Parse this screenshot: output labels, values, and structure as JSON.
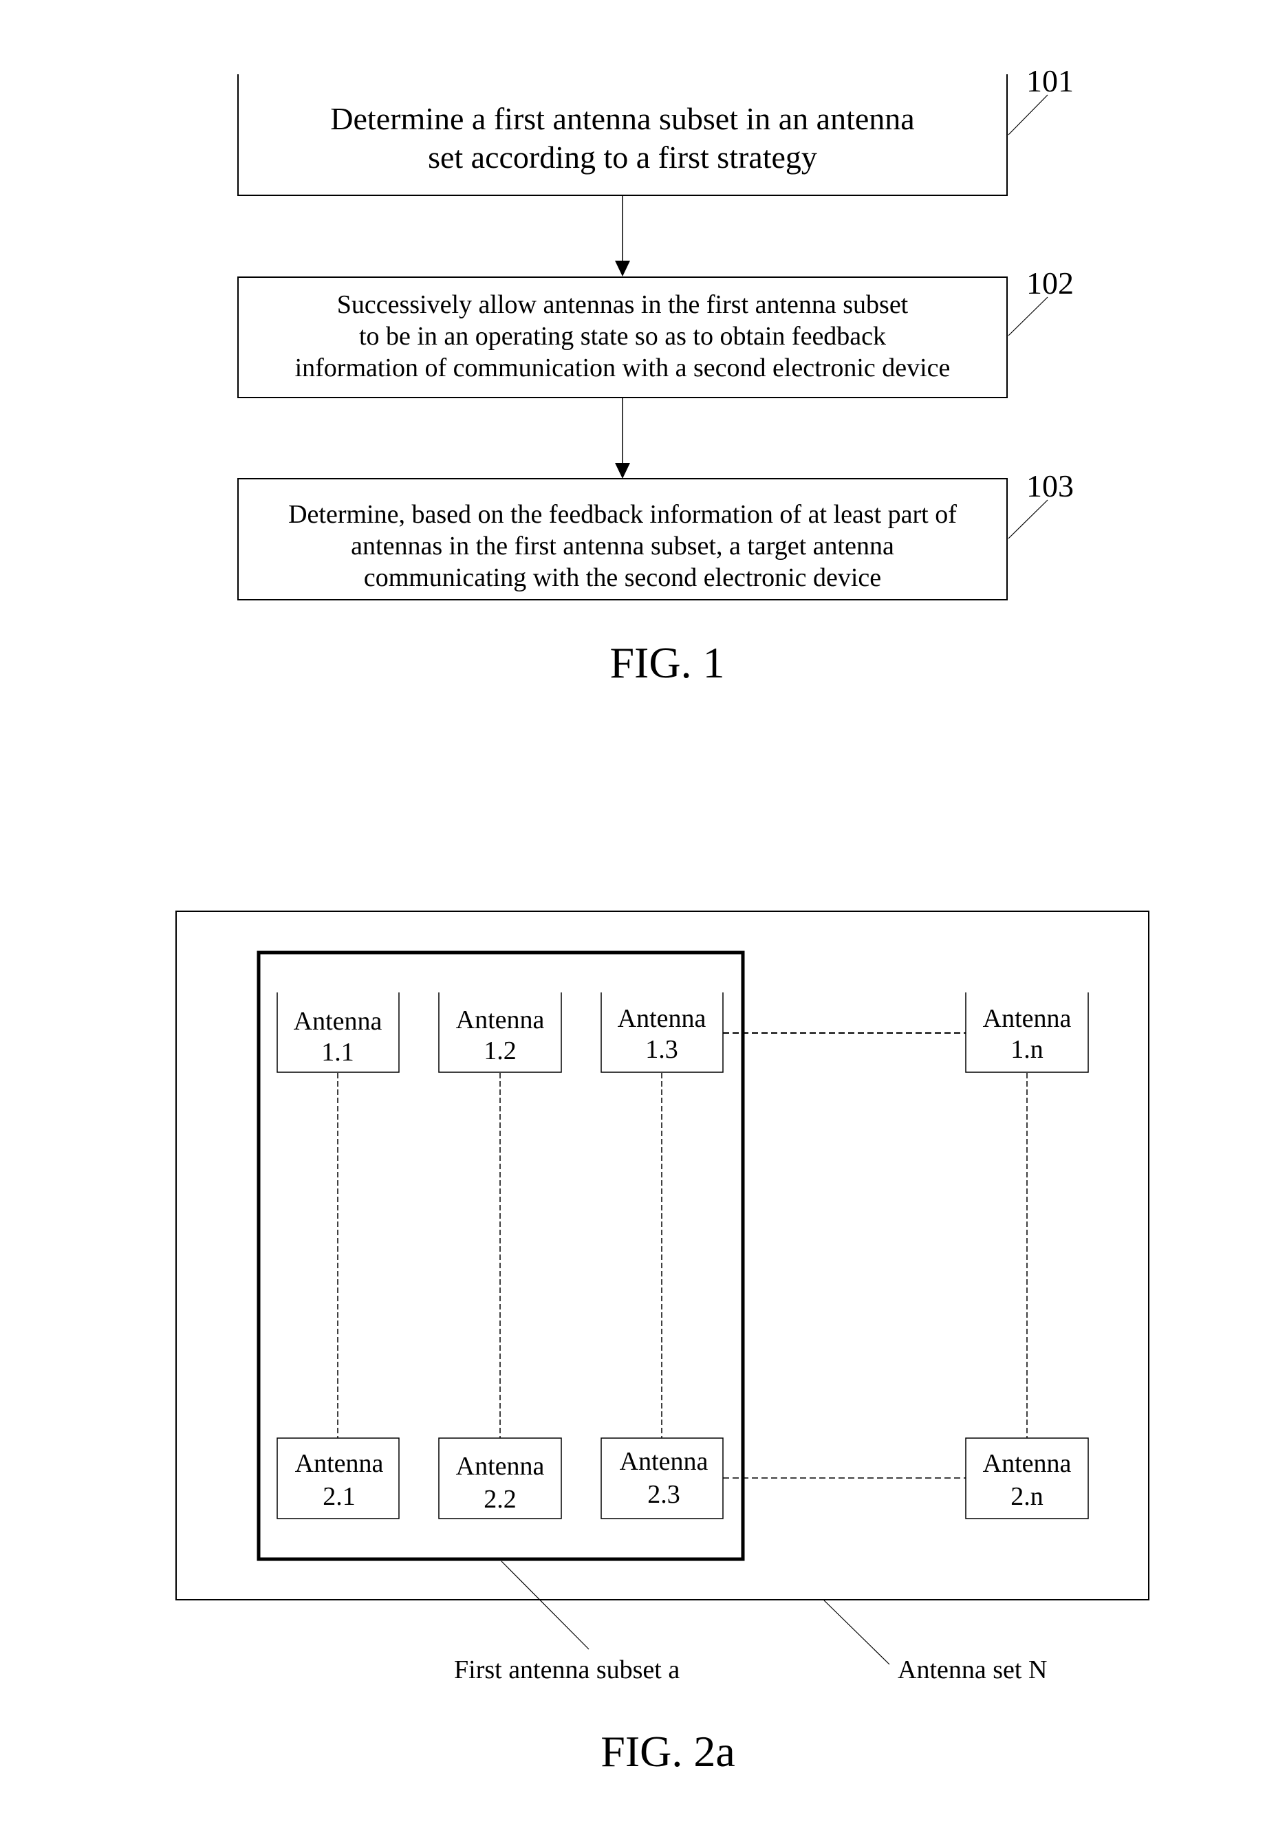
{
  "fig1": {
    "caption": "FIG. 1",
    "steps": [
      {
        "ref": "101",
        "lines": [
          "Determine a first antenna subset in an antenna",
          "set according to a first strategy"
        ]
      },
      {
        "ref": "102",
        "lines": [
          "Successively allow antennas in the first antenna subset",
          "to be in an operating state so as to obtain feedback",
          "information of communication with a second electronic device"
        ]
      },
      {
        "ref": "103",
        "lines": [
          "Determine, based on the feedback information of at least part of",
          "antennas in the first antenna subset, a target antenna",
          "communicating with the second electronic device"
        ]
      }
    ]
  },
  "fig2a": {
    "caption": "FIG. 2a",
    "antenna_word": "Antenna",
    "row1": [
      "1.1",
      "1.2",
      "1.3",
      "1.n"
    ],
    "row2": [
      "2.1",
      "2.2",
      "2.3",
      "2.n"
    ],
    "subset_label": "First antenna subset a",
    "set_label": "Antenna set N"
  }
}
